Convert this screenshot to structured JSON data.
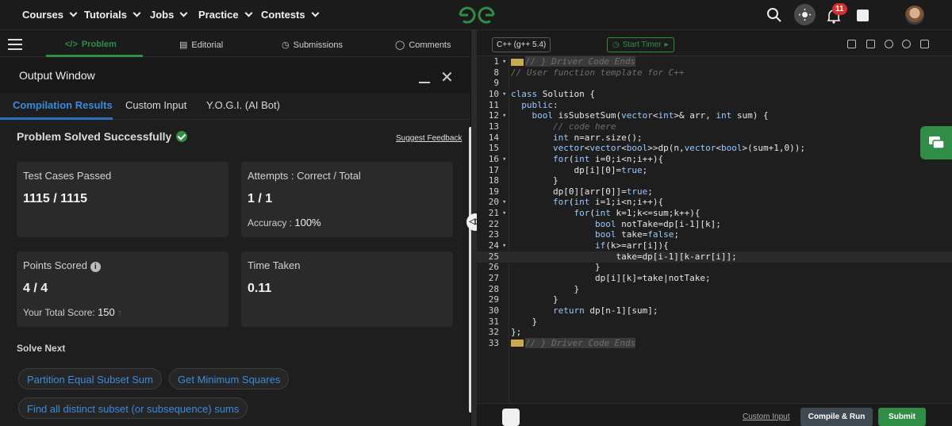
{
  "nav": {
    "menus": [
      "Courses",
      "Tutorials",
      "Jobs",
      "Practice",
      "Contests"
    ],
    "notification_count": "11"
  },
  "problem_tabs": {
    "problem": "Problem",
    "editorial": "Editorial",
    "submissions": "Submissions",
    "comments": "Comments"
  },
  "output": {
    "title": "Output Window",
    "tabs": [
      "Compilation Results",
      "Custom Input",
      "Y.O.G.I. (AI Bot)"
    ],
    "status": "Problem Solved Successfully",
    "feedback": "Suggest Feedback",
    "test_cases_label": "Test Cases Passed",
    "test_cases_value": "1115 / 1115",
    "attempts_label": "Attempts : Correct / Total",
    "attempts_value": "1 / 1",
    "accuracy_label": "Accuracy : ",
    "accuracy_value": "100%",
    "points_label": "Points Scored",
    "points_value": "4 / 4",
    "total_score_label": "Your Total Score: ",
    "total_score_value": "150",
    "time_label": "Time Taken",
    "time_value": "0.11",
    "solve_next_label": "Solve Next",
    "solve_next": [
      "Partition Equal Subset Sum",
      "Get Minimum Squares",
      "Find all distinct subset (or subsequence) sums"
    ]
  },
  "editor": {
    "language": "C++ (g++ 5.4)",
    "timer": "Start Timer",
    "custom_input": "Custom Input",
    "compile_run": "Compile & Run",
    "submit": "Submit",
    "lines": [
      {
        "n": "1",
        "t": "// } Driver Code Ends"
      },
      {
        "n": "8",
        "t": "// User function template for C++"
      },
      {
        "n": "9",
        "t": ""
      },
      {
        "n": "10",
        "t": "class Solution {"
      },
      {
        "n": "11",
        "t": "  public:"
      },
      {
        "n": "12",
        "t": "    bool isSubsetSum(vector<int>& arr, int sum) {"
      },
      {
        "n": "13",
        "t": "        // code here"
      },
      {
        "n": "14",
        "t": "        int n=arr.size();"
      },
      {
        "n": "15",
        "t": "        vector<vector<bool>>dp(n,vector<bool>(sum+1,0));"
      },
      {
        "n": "16",
        "t": "        for(int i=0;i<n;i++){"
      },
      {
        "n": "17",
        "t": "            dp[i][0]=true;"
      },
      {
        "n": "18",
        "t": "        }"
      },
      {
        "n": "19",
        "t": "        dp[0][arr[0]]=true;"
      },
      {
        "n": "20",
        "t": "        for(int i=1;i<n;i++){"
      },
      {
        "n": "21",
        "t": "            for(int k=1;k<=sum;k++){"
      },
      {
        "n": "22",
        "t": "                bool notTake=dp[i-1][k];"
      },
      {
        "n": "23",
        "t": "                bool take=false;"
      },
      {
        "n": "24",
        "t": "                if(k>=arr[i]){"
      },
      {
        "n": "25",
        "t": "                    take=dp[i-1][k-arr[i]];"
      },
      {
        "n": "26",
        "t": "                }"
      },
      {
        "n": "27",
        "t": "                dp[i][k]=take|notTake;"
      },
      {
        "n": "28",
        "t": "            }"
      },
      {
        "n": "29",
        "t": "        }"
      },
      {
        "n": "30",
        "t": "        return dp[n-1][sum];"
      },
      {
        "n": "31",
        "t": "    }"
      },
      {
        "n": "32",
        "t": "};"
      },
      {
        "n": "33",
        "t": "// } Driver Code Ends"
      }
    ]
  }
}
